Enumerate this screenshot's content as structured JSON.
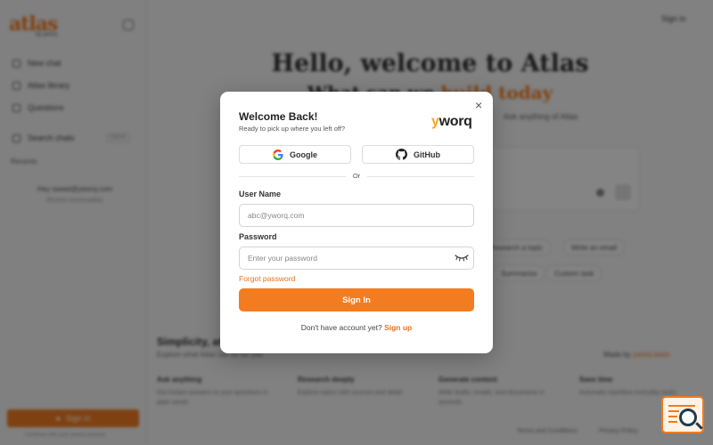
{
  "background": {
    "logo_text": "atlas",
    "logo_sub": "by yworq",
    "sidebar": {
      "items": [
        {
          "label": "New chat",
          "icon": "plus-icon"
        },
        {
          "label": "Atlas library",
          "icon": "book-icon"
        },
        {
          "label": "Questions",
          "icon": "question-icon"
        },
        {
          "label": "Search chats",
          "icon": "search-icon"
        }
      ],
      "search_shortcut": "Ctrl+K",
      "recent_title": "Recents",
      "recent_items": [
        "Hey sweet@yworq.com",
        "Recent conversation"
      ],
      "signin_label": "Sign in",
      "footer": "Continue with your yworq account"
    },
    "top_signin": "Sign in",
    "hero": {
      "title": "Hello, welcome to Atlas",
      "subtitle_prefix": "What can we ",
      "subtitle_accent": "build today",
      "desc": "Ask anything of Atlas"
    },
    "chips": [
      "Research a topic",
      "Write an email",
      "Summarize",
      "Custom task"
    ],
    "section": {
      "title": "Simplicity, at scale",
      "subtitle": "Explore what Atlas can do for you",
      "see_all_prefix": "Made by ",
      "see_all_accent": "yworq team"
    },
    "features": [
      {
        "title": "Ask anything",
        "desc": "Get instant answers to your questions in plain words"
      },
      {
        "title": "Research deeply",
        "desc": "Explore topics with sources and detail"
      },
      {
        "title": "Generate content",
        "desc": "Write drafts, emails, and documents in seconds"
      },
      {
        "title": "Save time",
        "desc": "Automate repetitive everyday tasks"
      }
    ],
    "bottom_links": [
      "Terms and Conditions",
      "Privacy Policy",
      "Support"
    ]
  },
  "modal": {
    "title": "Welcome Back!",
    "subtitle": "Ready to pick up where you left off?",
    "brand_y": "y",
    "brand_rest": "worq",
    "close_glyph": "×",
    "google_label": "Google",
    "github_label": "GitHub",
    "or_text": "Or",
    "username_label": "User Name",
    "username_placeholder": "abc@yworq.com",
    "username_value": "",
    "password_label": "Password",
    "password_placeholder": "Enter your password",
    "password_value": "",
    "forgot_label": "Forgot password",
    "signin_label": "Sign In",
    "signup_prompt": "Don't have account yet?",
    "signup_link": "Sign up"
  },
  "colors": {
    "accent": "#f47c20",
    "overlay": "rgba(0,0,0,0.47)",
    "brand_y": "#f5a623"
  },
  "icons": {
    "close": "close-icon",
    "google": "google-icon",
    "github": "github-icon",
    "eye": "eye-closed-icon",
    "chat": "chat-search-icon"
  }
}
